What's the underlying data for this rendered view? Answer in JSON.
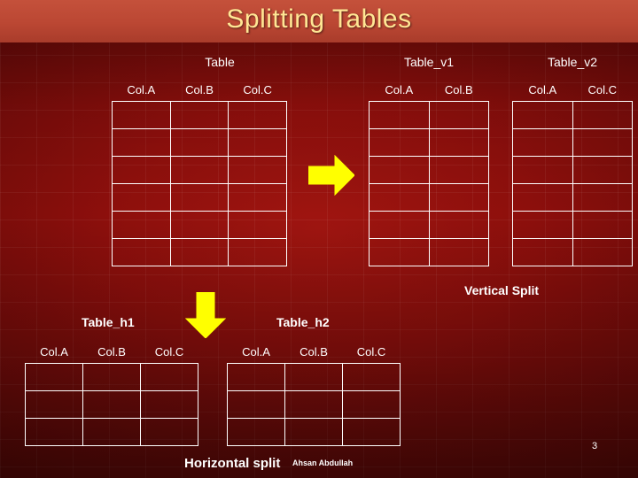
{
  "slide": {
    "title": "Splitting Tables",
    "page_number": "3",
    "credit": "Ahsan Abdullah",
    "colors": {
      "title_text": "#ffe694",
      "title_band": "#bb4733",
      "background": "#8d0f0c",
      "arrow": "#ffff00",
      "table_border": "#ffffff",
      "body_text": "#ffffff"
    }
  },
  "tables": {
    "original": {
      "caption": "Table",
      "columns": [
        "Col.A",
        "Col.B",
        "Col.C"
      ],
      "body_rows": 6
    },
    "vertical_1": {
      "caption": "Table_v1",
      "columns": [
        "Col.A",
        "Col.B"
      ],
      "body_rows": 6
    },
    "vertical_2": {
      "caption": "Table_v2",
      "columns": [
        "Col.A",
        "Col.C"
      ],
      "body_rows": 6
    },
    "horizontal_1": {
      "caption": "Table_h1",
      "columns": [
        "Col.A",
        "Col.B",
        "Col.C"
      ],
      "body_rows": 3
    },
    "horizontal_2": {
      "caption": "Table_h2",
      "columns": [
        "Col.A",
        "Col.B",
        "Col.C"
      ],
      "body_rows": 3
    }
  },
  "annotations": {
    "vertical_split": "Vertical Split",
    "horizontal_split": "Horizontal split"
  },
  "icons": {
    "arrow_right": "arrow-right-icon",
    "arrow_down": "arrow-down-icon"
  }
}
